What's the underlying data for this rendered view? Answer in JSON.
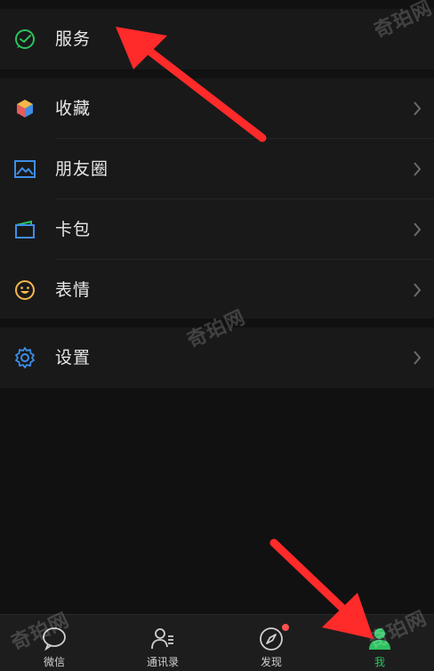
{
  "menu": {
    "services": {
      "label": "服务",
      "icon": "wechat-pay-icon"
    },
    "items": [
      {
        "label": "收藏",
        "icon": "favorites-cube-icon"
      },
      {
        "label": "朋友圈",
        "icon": "moments-image-icon"
      },
      {
        "label": "卡包",
        "icon": "card-wallet-icon"
      },
      {
        "label": "表情",
        "icon": "sticker-smile-icon"
      }
    ],
    "settings": {
      "label": "设置",
      "icon": "gear-icon"
    }
  },
  "tabbar": {
    "tabs": [
      {
        "label": "微信",
        "icon": "chat-bubble-icon"
      },
      {
        "label": "通讯录",
        "icon": "contacts-icon"
      },
      {
        "label": "发现",
        "icon": "compass-icon",
        "badge": true
      },
      {
        "label": "我",
        "icon": "person-icon",
        "active": true
      }
    ]
  },
  "watermark": {
    "text": "奇珀网"
  },
  "colors": {
    "accent": "#2ec160",
    "annotation_arrow": "#ff2a2a",
    "badge": "#fa5151"
  }
}
